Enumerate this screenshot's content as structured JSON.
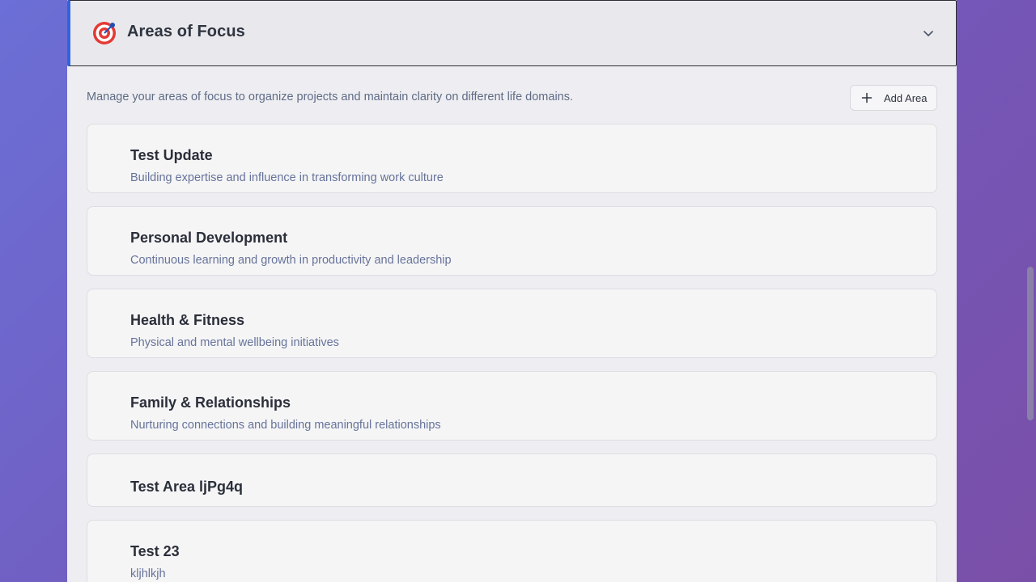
{
  "section": {
    "icon": "target-icon",
    "title": "Areas of Focus",
    "toggle_icon": "chevron-down-icon"
  },
  "intro": "Manage your areas of focus to organize projects and maintain clarity on different life domains.",
  "add_button": {
    "icon": "plus-icon",
    "label": "Add Area"
  },
  "areas": [
    {
      "title": "Test Update",
      "description": "Building expertise and influence in transforming work culture"
    },
    {
      "title": "Personal Development",
      "description": "Continuous learning and growth in productivity and leadership"
    },
    {
      "title": "Health & Fitness",
      "description": "Physical and mental wellbeing initiatives"
    },
    {
      "title": "Family & Relationships",
      "description": "Nurturing connections and building meaningful relationships"
    },
    {
      "title": "Test Area ljPg4q",
      "description": ""
    },
    {
      "title": "Test 23",
      "description": "kljhlkjh"
    }
  ],
  "colors": {
    "accent": "#2f64e0",
    "title_text": "#2e3440",
    "muted_text": "#66739a"
  }
}
